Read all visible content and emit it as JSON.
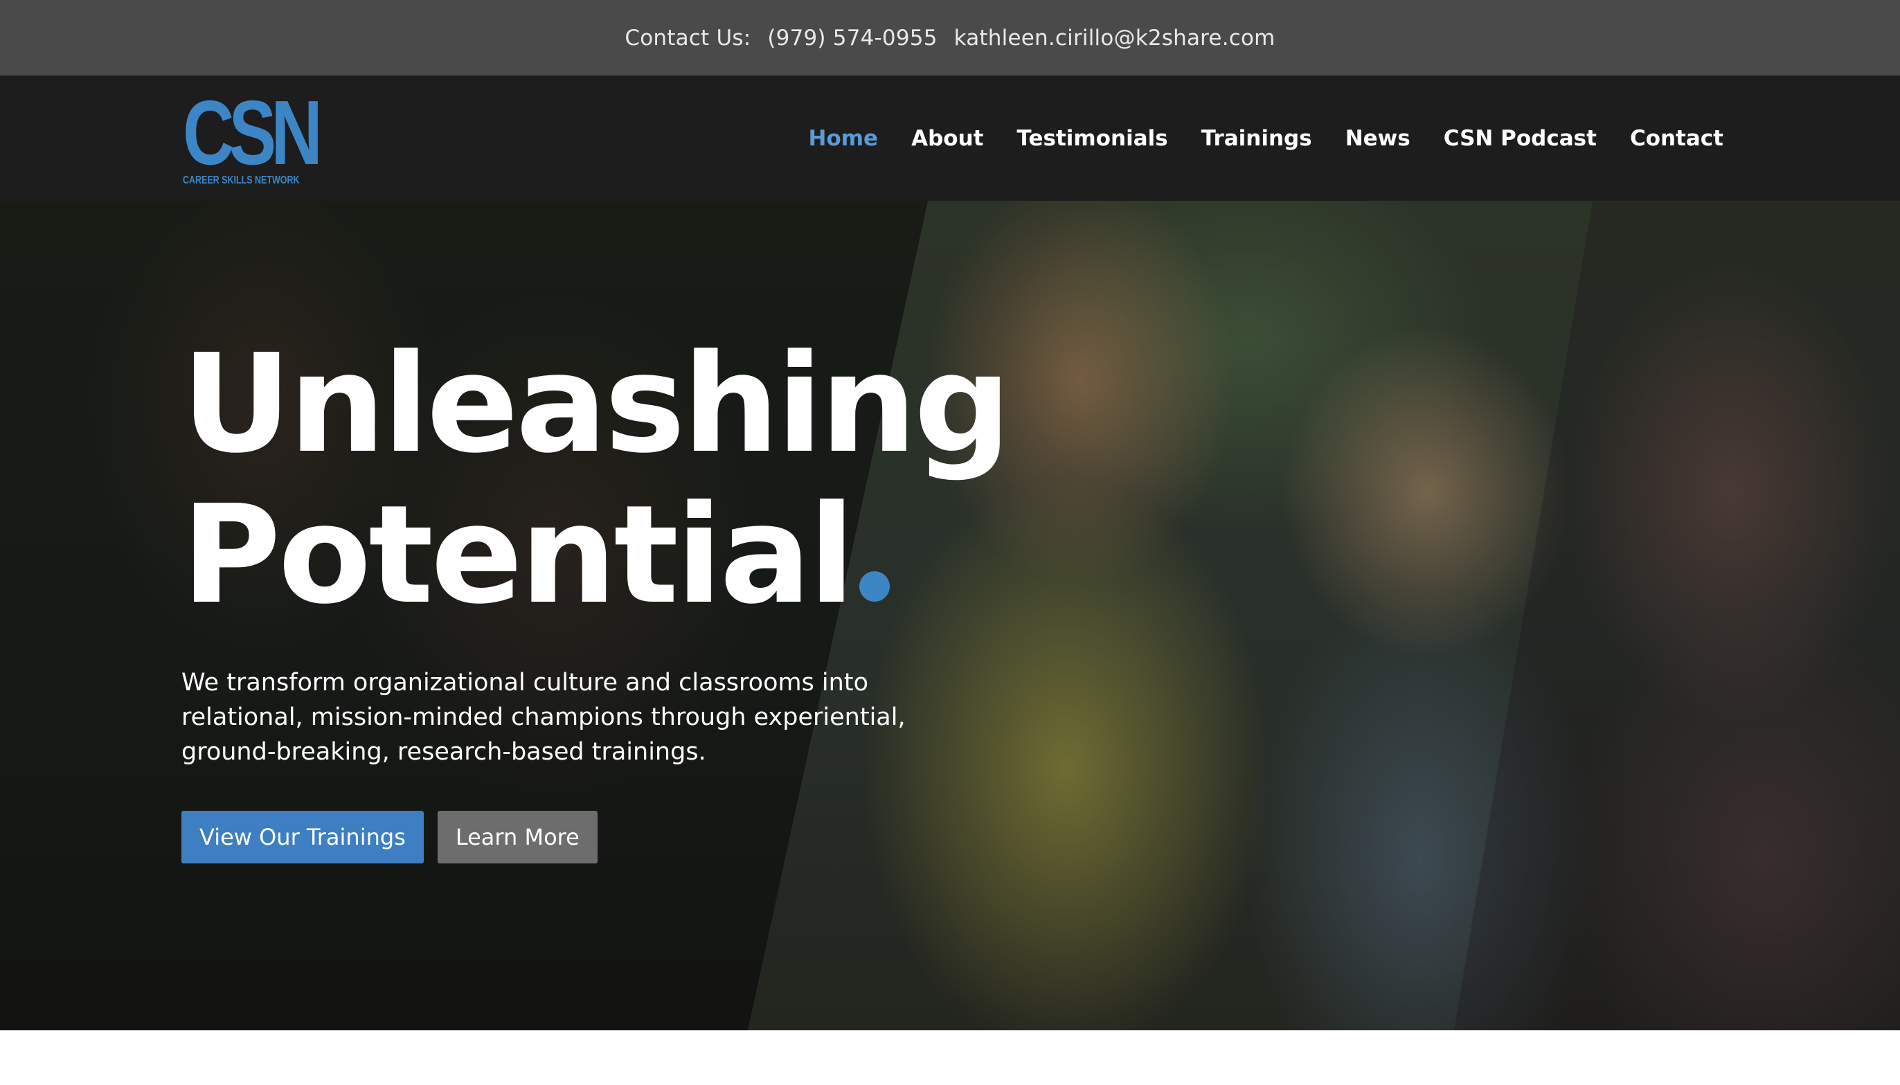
{
  "topbar": {
    "label": "Contact Us:",
    "phone": "(979) 574-0955",
    "email": "kathleen.cirillo@k2share.com"
  },
  "logo": {
    "mark": "CSN",
    "subtitle": "CAREER SKILLS NETWORK"
  },
  "nav": {
    "items": [
      {
        "label": "Home",
        "active": true
      },
      {
        "label": "About"
      },
      {
        "label": "Testimonials"
      },
      {
        "label": "Trainings"
      },
      {
        "label": "News"
      },
      {
        "label": "CSN Podcast"
      },
      {
        "label": "Contact"
      }
    ]
  },
  "hero": {
    "title_line1": "Unleashing",
    "title_line2": "Potential",
    "description": "We transform organizational culture and classrooms into relational, mission-minded champions through experiential, ground-breaking, research-based trainings.",
    "primary_button": "View Our Trainings",
    "secondary_button": "Learn More"
  },
  "colors": {
    "accent": "#3d86c6",
    "nav_active": "#5b9bd5",
    "topbar_bg": "#4a4a4a",
    "header_bg": "#1d1d1d",
    "secondary_button": "#6d6d6d"
  }
}
